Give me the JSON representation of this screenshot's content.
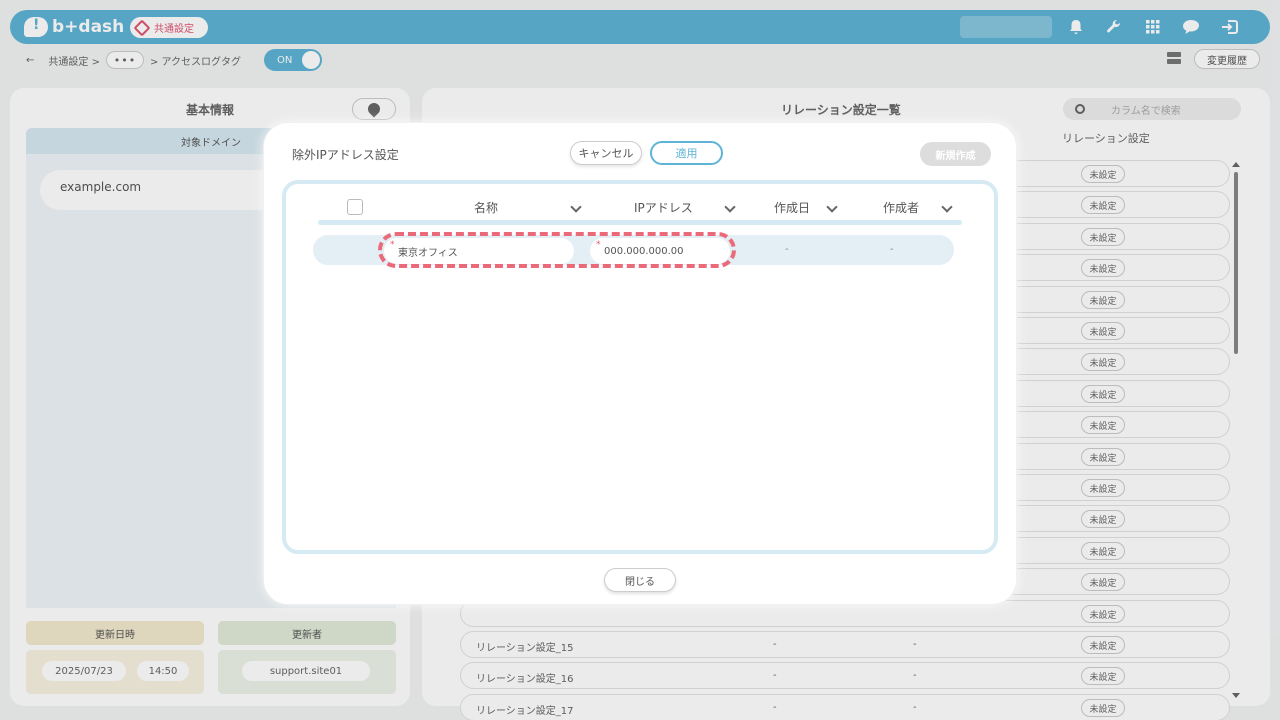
{
  "header": {
    "logo": "b+dash",
    "common_badge": "共通設定",
    "icons": [
      "bell-icon",
      "wrench-icon",
      "grid-icon",
      "chat-icon",
      "logout-icon"
    ]
  },
  "breadcrumb": {
    "back": "←",
    "item1": "共通設定 >",
    "dots": "•••",
    "item2": "> アクセスログタグ",
    "toggle": "ON",
    "history_button": "変更履歴"
  },
  "left_panel": {
    "title": "基本情報",
    "domain_header": "対象ドメイン",
    "domain_value": "example.com",
    "updated_at_label": "更新日時",
    "updated_by_label": "更新者",
    "date": "2025/07/23",
    "time": "14:50",
    "updater": "support.site01"
  },
  "right_panel": {
    "title": "リレーション設定一覧",
    "search_placeholder": "カラム名で検索",
    "col_relation": "リレーション設定",
    "status_label": "未設定",
    "rows": [
      {
        "name": "",
        "d1": "",
        "d2": ""
      },
      {
        "name": "リレーション設定_15",
        "d1": "-",
        "d2": "-"
      },
      {
        "name": "リレーション設定_16",
        "d1": "-",
        "d2": "-"
      },
      {
        "name": "リレーション設定_17",
        "d1": "-",
        "d2": "-"
      }
    ]
  },
  "modal": {
    "title": "除外IPアドレス設定",
    "cancel": "キャンセル",
    "apply": "適用",
    "new": "新規作成",
    "columns": [
      "名称",
      "IPアドレス",
      "作成日",
      "作成者"
    ],
    "row": {
      "name": "東京オフィス",
      "ip": "000.000.000.00",
      "created": "-",
      "creator": "-",
      "required_mark": "*"
    },
    "close": "閉じる"
  },
  "colors": {
    "accent": "#5fb4d6",
    "highlight": "#ea6a7a",
    "danger": "#e0556d"
  }
}
